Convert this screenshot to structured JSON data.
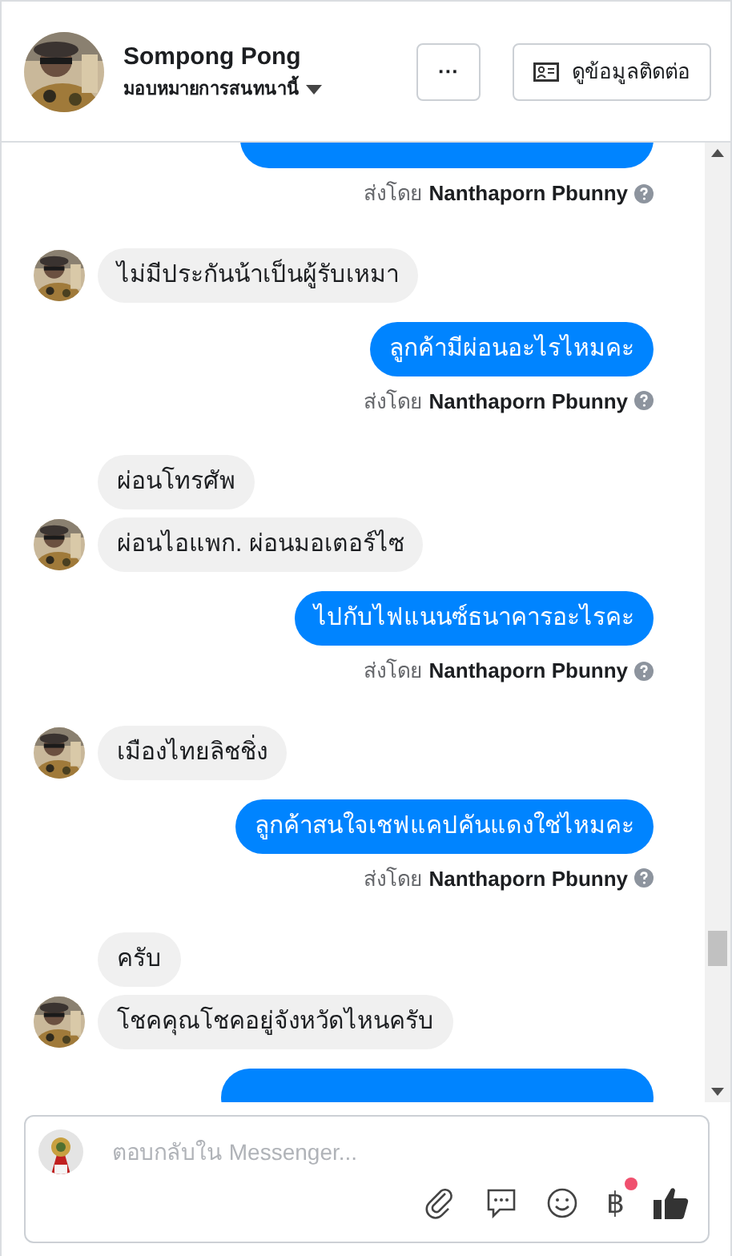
{
  "header": {
    "name": "Sompong Pong",
    "assign_label": "มอบหมายการสนทนานี้",
    "more_button": "···",
    "contact_button": "ดูข้อมูลติดต่อ"
  },
  "messages": [
    {
      "kind": "outgoing-cut-top",
      "sent_by": "ส่งโดย **Nanthaporn Pbunny**"
    },
    {
      "kind": "incoming",
      "avatar": true,
      "text": "ไม่มีประกันน้าเป็นผู้รับเหมา"
    },
    {
      "kind": "outgoing",
      "text": "ลูกค้ามีผ่อนอะไรไหมคะ",
      "sent_by": "ส่งโดย **Nanthaporn Pbunny**"
    },
    {
      "kind": "incoming",
      "avatar": false,
      "text": "ผ่อนโทรศัพ"
    },
    {
      "kind": "incoming",
      "avatar": true,
      "text": "ผ่อนไอแพก. ผ่อนมอเตอร์ไซ"
    },
    {
      "kind": "outgoing",
      "text": "ไปกับไฟแนนซ์ธนาคารอะไรคะ",
      "sent_by": "ส่งโดย **Nanthaporn Pbunny**"
    },
    {
      "kind": "incoming",
      "avatar": true,
      "text": "เมืองไทยลิชชิ่ง"
    },
    {
      "kind": "outgoing",
      "text": "ลูกค้าสนใจเชฟแคปคันแดงใช่ไหมคะ",
      "sent_by": "ส่งโดย **Nanthaporn Pbunny**"
    },
    {
      "kind": "incoming",
      "avatar": false,
      "text": "ครับ"
    },
    {
      "kind": "incoming",
      "avatar": true,
      "text": "โชคคุณโชคอยู่จังหวัดไหนครับ"
    },
    {
      "kind": "outgoing-cut-bottom"
    }
  ],
  "composer": {
    "placeholder": "ตอบกลับใน Messenger...",
    "currency_symbol": "฿",
    "currency_notification": true
  }
}
